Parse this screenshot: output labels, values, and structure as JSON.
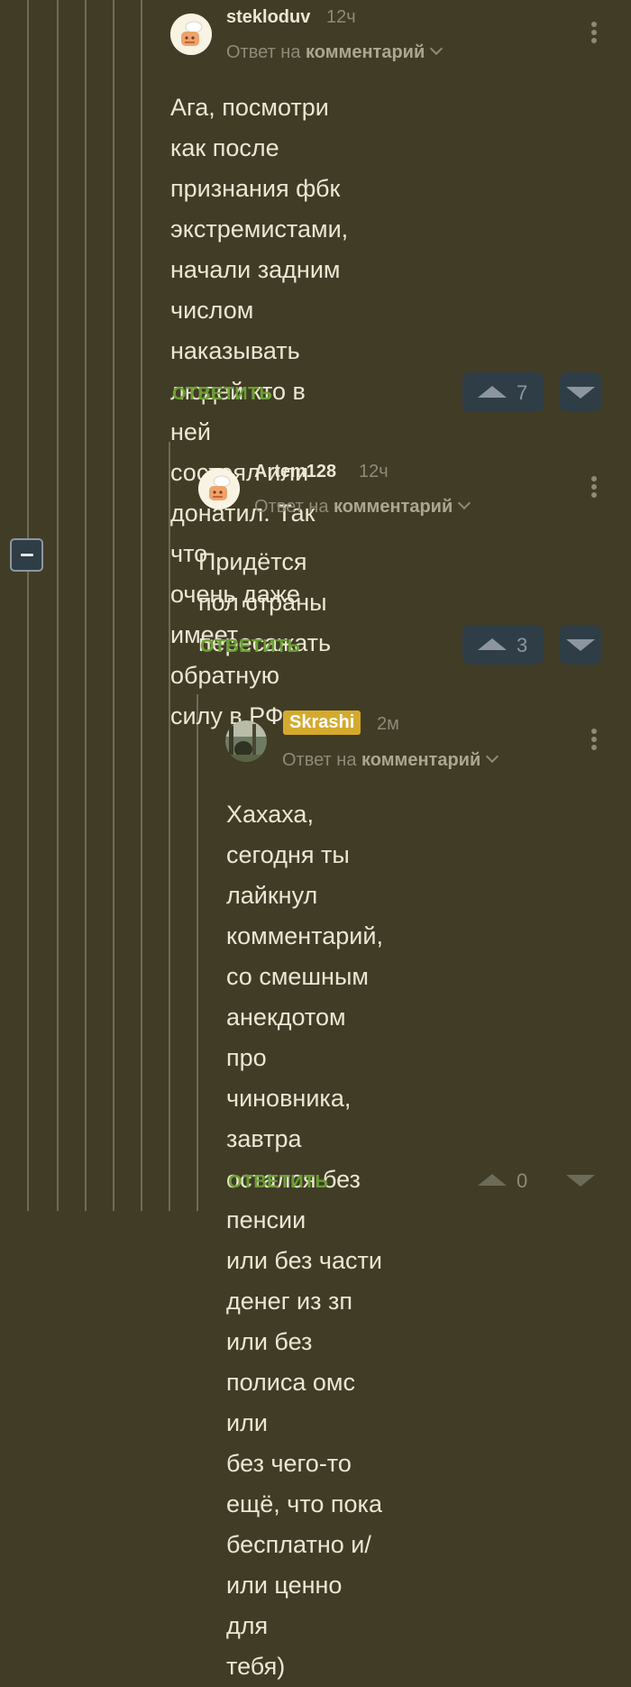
{
  "comments": [
    {
      "username": "stekloduv",
      "time": "12ч",
      "reply_prefix": "Ответ на",
      "reply_target": "комментарий",
      "text": "Ага, посмотри как после\nпризнания фбк экстремистами,\nначали задним числом\nнаказывать людей кто в ней\nсостоял или донатил. Так что\nочень даже имеет обратную\nсилу в РФ",
      "reply_label": "ОТВЕТИТЬ",
      "votes": "7",
      "avatar_icon": "cartoon-chef-avatar-icon"
    },
    {
      "username": "Artem128",
      "time": "12ч",
      "reply_prefix": "Ответ на",
      "reply_target": "комментарий",
      "text": "Придётся пол страны\nпересажать",
      "reply_label": "ОТВЕТИТЬ",
      "votes": "3",
      "avatar_icon": "cartoon-chef-avatar-icon"
    },
    {
      "username": "Skrashi",
      "time": "2м",
      "reply_prefix": "Ответ на",
      "reply_target": "комментарий",
      "text": "Хахаха, сегодня ты лайкнул\nкомментарий, со смешным\nанекдотом про чиновника,\nзавтра остался без пенсии\nили без части денег из зп\nили без полиса омс или\nбез чего-то ещё, что пока\nбесплатно и/или ценно для\nтебя)",
      "reply_label": "ОТВЕТИТЬ",
      "votes": "0",
      "avatar_icon": "forest-photo-avatar-icon"
    }
  ],
  "colors": {
    "background": "#413c26",
    "username_badge": "#d5a92c",
    "reply_green": "#6aa032",
    "vote_button": "#2f3d47"
  }
}
